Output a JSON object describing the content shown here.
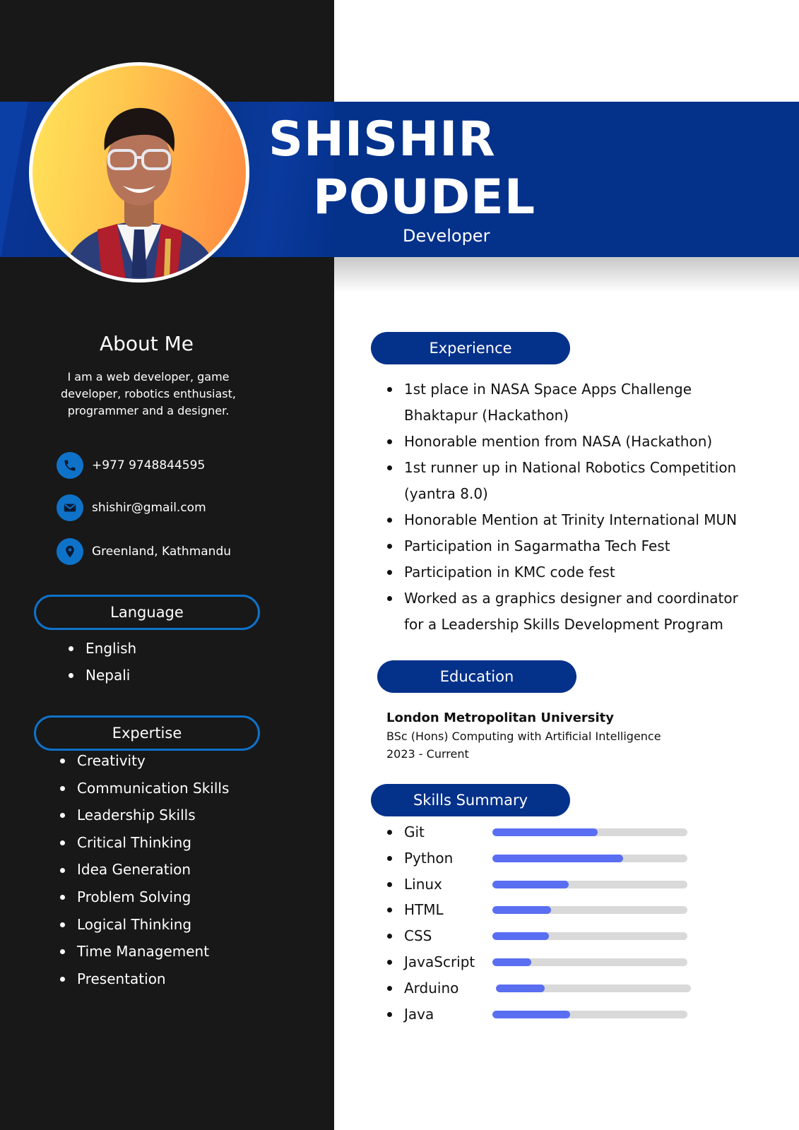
{
  "header": {
    "first_name": "SHISHIR",
    "last_name": "POUDEL",
    "role": "Developer"
  },
  "about": {
    "title": "About Me",
    "text": "I am a web developer, game developer, robotics enthusiast, programmer and a designer."
  },
  "contact": {
    "phone": "+977 9748844595",
    "email": "shishir@gmail.com",
    "location": "Greenland, Kathmandu",
    "icons": [
      "phone-icon",
      "mail-icon",
      "location-pin-icon"
    ]
  },
  "language": {
    "title": "Language",
    "items": [
      "English",
      "Nepali"
    ]
  },
  "expertise": {
    "title": "Expertise",
    "items": [
      "Creativity",
      "Communication Skills",
      "Leadership Skills",
      "Critical Thinking",
      "Idea Generation",
      "Problem Solving",
      "Logical Thinking",
      "Time Management",
      "Presentation"
    ]
  },
  "experience": {
    "title": "Experience",
    "items": [
      "1st place in NASA Space Apps Challenge Bhaktapur (Hackathon)",
      "Honorable mention from NASA (Hackathon)",
      "1st runner up in National Robotics Competition (yantra 8.0)",
      "Honorable Mention at Trinity International MUN",
      "Participation in Sagarmatha Tech Fest",
      "Participation in KMC code fest",
      "Worked as a graphics designer and coordinator for a Leadership Skills Development Program"
    ]
  },
  "education": {
    "title": "Education",
    "school": "London Metropolitan University",
    "degree": "BSc (Hons) Computing with Artificial Intelligence",
    "dates": "2023 - Current"
  },
  "skills": {
    "title": "Skills Summary",
    "items": [
      {
        "name": "Git",
        "level": 0.54
      },
      {
        "name": "Python",
        "level": 0.67
      },
      {
        "name": "Linux",
        "level": 0.39
      },
      {
        "name": "HTML",
        "level": 0.3
      },
      {
        "name": "CSS",
        "level": 0.29
      },
      {
        "name": "JavaScript",
        "level": 0.2
      },
      {
        "name": "Arduino",
        "level": 0.25
      },
      {
        "name": "Java",
        "level": 0.4
      }
    ]
  },
  "colors": {
    "sidebar": "#181818",
    "banner": "#04318a",
    "accent": "#0f72c9",
    "skill_fill": "#5a6ef2",
    "skill_track": "#d9d9d9"
  }
}
